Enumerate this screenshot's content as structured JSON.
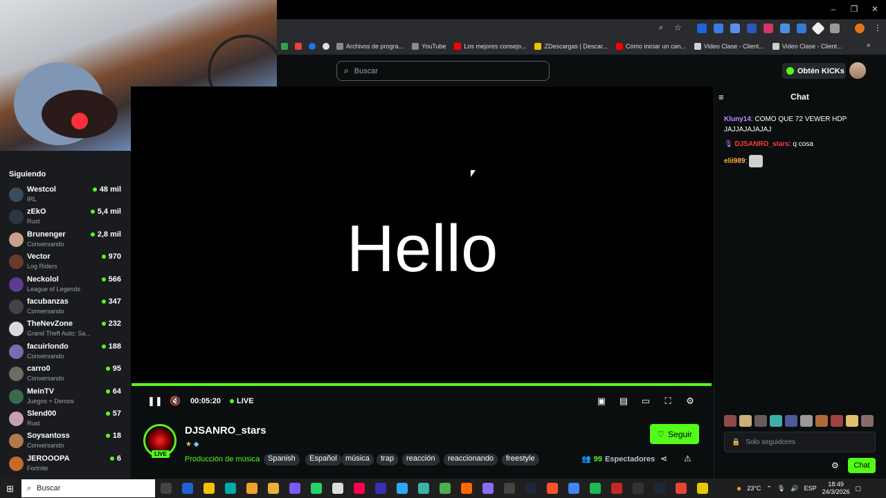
{
  "browser": {
    "bookmarks": [
      {
        "label": "Archivos de progra...",
        "color": "#8a8a8a"
      },
      {
        "label": "YouTube",
        "color": "#8a8a8a"
      },
      {
        "label": "Los mejores consejo...",
        "color": "#ff0000"
      },
      {
        "label": "ZDescargas | Descar...",
        "color": "#f2c200"
      },
      {
        "label": "Cómo iniciar un can...",
        "color": "#ff0000"
      },
      {
        "label": "Video Clase - Client...",
        "color": "#cfcfcf"
      },
      {
        "label": "Video Clase - Client...",
        "color": "#cfcfcf"
      }
    ]
  },
  "header": {
    "search_placeholder": "Buscar",
    "kicks_label": "Obtén KICKs"
  },
  "sidebar": {
    "title": "Siguiendo",
    "items": [
      {
        "name": "Westcol",
        "category": "IRL",
        "viewers": "48 mil",
        "color": "#3a4d5c"
      },
      {
        "name": "zEkO",
        "category": "Rust",
        "viewers": "5,4 mil",
        "color": "#2d3640"
      },
      {
        "name": "Brunenger",
        "category": "Conversando",
        "viewers": "2,8 mil",
        "color": "#c9a08a"
      },
      {
        "name": "Vector",
        "category": "Log Riders",
        "viewers": "970",
        "color": "#6a3b2c"
      },
      {
        "name": "Neckolol",
        "category": "League of Legends",
        "viewers": "566",
        "color": "#5b3c8e"
      },
      {
        "name": "facubanzas",
        "category": "Conversando",
        "viewers": "347",
        "color": "#444"
      },
      {
        "name": "TheNevZone",
        "category": "Grand Theft Auto: Sa...",
        "viewers": "232",
        "color": "#d9d9d9"
      },
      {
        "name": "facuirlondo",
        "category": "Conversando",
        "viewers": "188",
        "color": "#7d6ab0"
      },
      {
        "name": "carro0",
        "category": "Conversando",
        "viewers": "95",
        "color": "#6d6d5d"
      },
      {
        "name": "MeinTV",
        "category": "Juegos + Demos",
        "viewers": "64",
        "color": "#3b6a4a"
      },
      {
        "name": "Slend00",
        "category": "Rust",
        "viewers": "57",
        "color": "#c6a0b0"
      },
      {
        "name": "Soysantoss",
        "category": "Conversando",
        "viewers": "18",
        "color": "#b07a4a"
      },
      {
        "name": "JEROOOPA",
        "category": "Fortnite",
        "viewers": "6",
        "color": "#c46a2a"
      }
    ]
  },
  "player": {
    "screen_text": "Hello",
    "time": "00:05:20",
    "live_label": "LIVE"
  },
  "channel": {
    "name": "DJSANRO_stars",
    "live_badge": "LIVE",
    "category": "Producción de música",
    "tags": [
      "Spanish",
      "Español",
      "música",
      "trap",
      "reacción",
      "reaccionando",
      "freestyle"
    ],
    "follow_label": "Seguir",
    "viewers_count": "99",
    "viewers_label": "Espectadores"
  },
  "chat": {
    "title": "Chat",
    "messages": [
      {
        "user": "Kluny14",
        "user_color": "#b98cff",
        "text": ": COMO QUE 72 VEWER HDP JAJJAJAJAJAJ"
      },
      {
        "user": "DJSANRO_stars",
        "user_color": "#ff3b3b",
        "text": ": q cosa"
      },
      {
        "user": "elii989",
        "user_color": "#ffb23b",
        "text": ":"
      }
    ],
    "input_placeholder": "Solo seguidores",
    "send_label": "Chat"
  },
  "taskbar": {
    "search_label": "Buscar",
    "temperature": "23°C",
    "language": "ESP",
    "time": "18:49",
    "date": "24/3/2026"
  }
}
